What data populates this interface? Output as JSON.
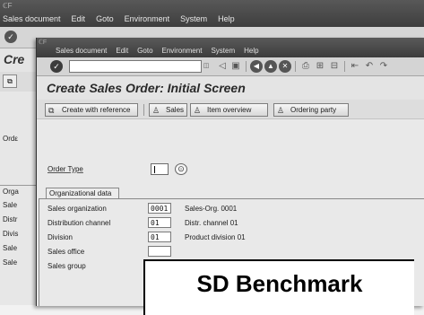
{
  "back_window": {
    "sap_corner": "ℂF",
    "menu": [
      "Sales document",
      "Edit",
      "Goto",
      "Environment",
      "System",
      "Help"
    ],
    "title_fragment": "Cre",
    "side_labels": [
      "Ordε",
      "Orga",
      "Sale",
      "Distr",
      "Divis",
      "Sale",
      "Sale"
    ]
  },
  "front_window": {
    "sap_corner": "ℂF",
    "menu": [
      "Sales document",
      "Edit",
      "Goto",
      "Environment",
      "System",
      "Help"
    ],
    "title": "Create Sales Order: Initial Screen",
    "app_toolbar": {
      "create_with_reference": "Create with reference",
      "sales": "Sales",
      "item_overview": "Item overview",
      "ordering_party": "Ordering party"
    },
    "order_type": {
      "label": "Order Type",
      "value": ""
    },
    "org_data": {
      "tab_label": "Organizational data",
      "rows": [
        {
          "label": "Sales organization",
          "value": "0001",
          "desc": "Sales-Org. 0001"
        },
        {
          "label": "Distribution channel",
          "value": "01",
          "desc": "Distr. channel 01"
        },
        {
          "label": "Division",
          "value": "01",
          "desc": "Product division 01"
        },
        {
          "label": "Sales office",
          "value": "",
          "desc": ""
        },
        {
          "label": "Sales group",
          "value": "",
          "desc": ""
        }
      ]
    }
  },
  "overlay": {
    "label": "SD Benchmark"
  },
  "colors": {
    "menubar": "#4a4a4a",
    "toolbar": "#d4d4d4",
    "body": "#e9e9e9"
  }
}
